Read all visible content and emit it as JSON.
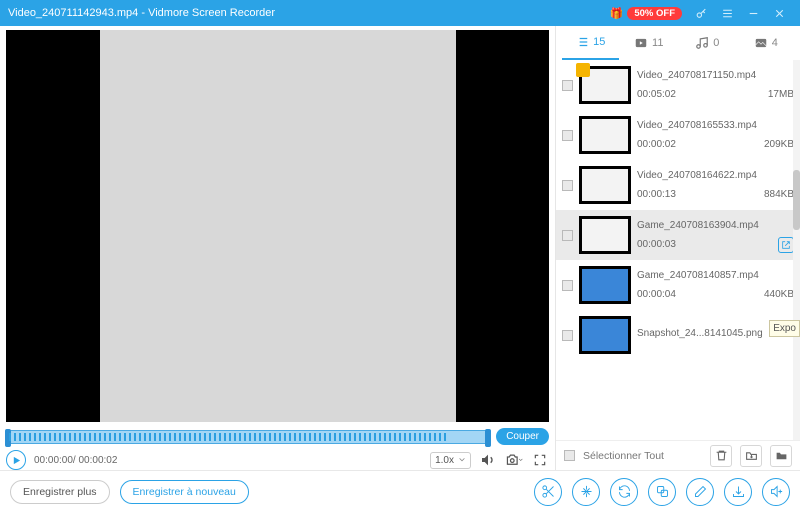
{
  "titlebar": {
    "filename": "Video_240711142943.mp4",
    "sep": "  -  ",
    "app": "Vidmore Screen Recorder",
    "promo": "50% OFF"
  },
  "player": {
    "cut_label": "Couper",
    "time": "00:00:00/ 00:00:02",
    "speed": "1.0x"
  },
  "tabs": {
    "list_count": "15",
    "video_count": "11",
    "audio_count": "0",
    "image_count": "4"
  },
  "items": [
    {
      "name": "Video_240708171150.mp4",
      "dur": "00:05:02",
      "size": "17MB",
      "thumb": "doc",
      "crown": true
    },
    {
      "name": "Video_240708165533.mp4",
      "dur": "00:00:02",
      "size": "209KB",
      "thumb": "doc"
    },
    {
      "name": "Video_240708164622.mp4",
      "dur": "00:00:13",
      "size": "884KB",
      "thumb": "doc"
    },
    {
      "name": "Game_240708163904.mp4",
      "dur": "00:00:03",
      "size": "",
      "thumb": "doc",
      "selected": true,
      "share": true
    },
    {
      "name": "Game_240708140857.mp4",
      "dur": "00:00:04",
      "size": "440KB",
      "thumb": "blue"
    },
    {
      "name": "Snapshot_24...8141045.png",
      "dur": "",
      "size": "",
      "thumb": "blue"
    }
  ],
  "selall": {
    "label": "Sélectionner Tout"
  },
  "bottom": {
    "record_more": "Enregistrer plus",
    "record_again": "Enregistrer à nouveau"
  },
  "tooltip": "Expo"
}
